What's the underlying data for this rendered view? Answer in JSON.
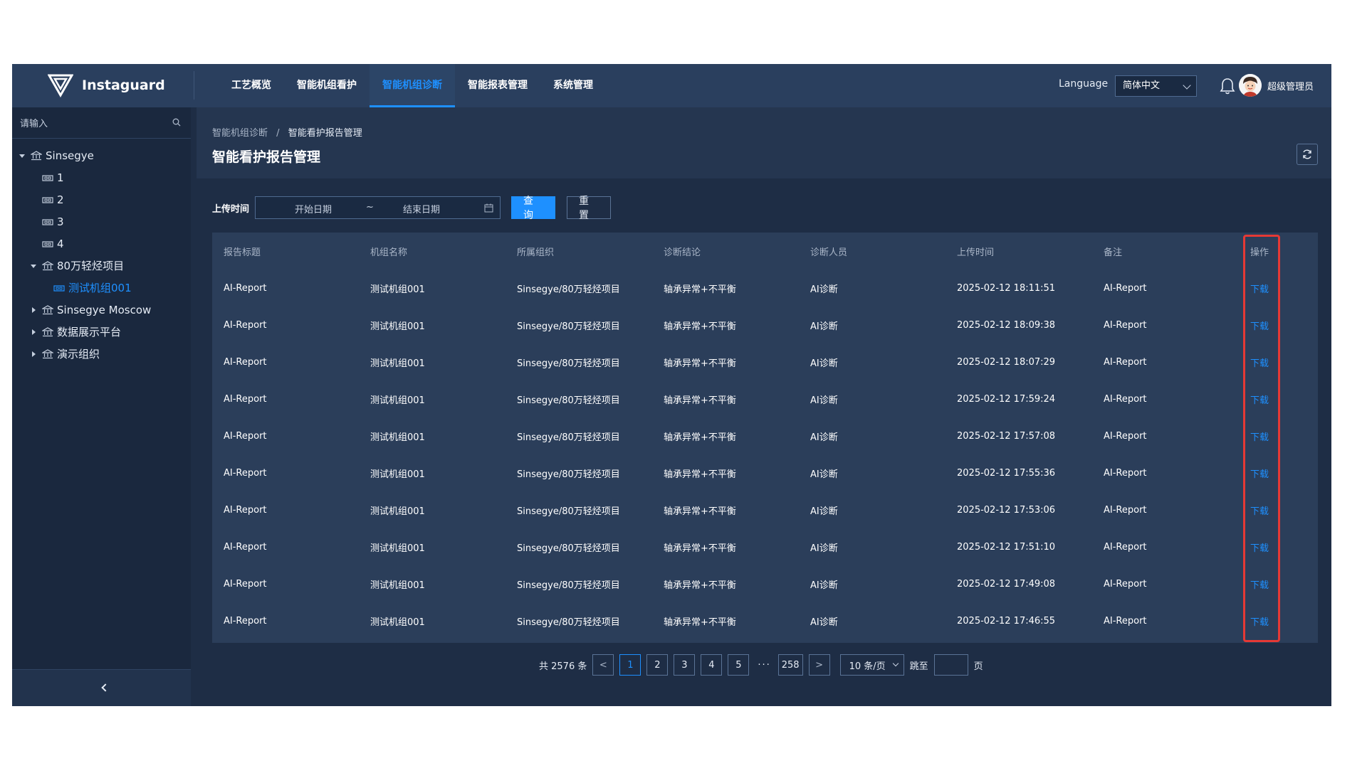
{
  "header": {
    "brand": "Instaguard",
    "nav": [
      {
        "label": "工艺概览",
        "active": false
      },
      {
        "label": "智能机组看护",
        "active": false
      },
      {
        "label": "智能机组诊断",
        "active": true
      },
      {
        "label": "智能报表管理",
        "active": false
      },
      {
        "label": "系统管理",
        "active": false
      }
    ],
    "language_label": "Language",
    "language_value": "简体中文",
    "user_name": "超级管理员"
  },
  "sidebar": {
    "search_placeholder": "请输入",
    "tree": [
      {
        "label": "Sinsegye",
        "level": 0,
        "caret": "down",
        "icon": "org-icon",
        "selected": false
      },
      {
        "label": "1",
        "level": 1,
        "caret": "none",
        "icon": "device-icon",
        "selected": false
      },
      {
        "label": "2",
        "level": 1,
        "caret": "none",
        "icon": "device-icon",
        "selected": false
      },
      {
        "label": "3",
        "level": 1,
        "caret": "none",
        "icon": "device-icon",
        "selected": false
      },
      {
        "label": "4",
        "level": 1,
        "caret": "none",
        "icon": "device-icon",
        "selected": false
      },
      {
        "label": "80万轻烃项目",
        "level": 1,
        "caret": "down",
        "icon": "org-icon",
        "selected": false
      },
      {
        "label": "测试机组001",
        "level": 2,
        "caret": "none",
        "icon": "device-icon",
        "selected": true
      },
      {
        "label": "Sinsegye Moscow",
        "level": 1,
        "caret": "right",
        "icon": "org-icon",
        "selected": false
      },
      {
        "label": "数据展示平台",
        "level": 1,
        "caret": "right",
        "icon": "org-icon",
        "selected": false
      },
      {
        "label": "演示组织",
        "level": 1,
        "caret": "right",
        "icon": "org-icon",
        "selected": false
      }
    ]
  },
  "main": {
    "breadcrumb": [
      "智能机组诊断",
      "智能看护报告管理"
    ],
    "breadcrumb_sep": "/",
    "title": "智能看护报告管理",
    "filter": {
      "label": "上传时间",
      "start_placeholder": "开始日期",
      "tilde": "~",
      "end_placeholder": "结束日期",
      "query_label": "查 询",
      "reset_label": "重 置"
    },
    "table": {
      "columns": [
        "报告标题",
        "机组名称",
        "所属组织",
        "诊断结论",
        "诊断人员",
        "上传时间",
        "备注",
        "操作"
      ],
      "rows": [
        [
          "AI-Report",
          "测试机组001",
          "Sinsegye/80万轻烃项目",
          "轴承异常+不平衡",
          "AI诊断",
          "2025-02-12 18:11:51",
          "AI-Report",
          "下载"
        ],
        [
          "AI-Report",
          "测试机组001",
          "Sinsegye/80万轻烃项目",
          "轴承异常+不平衡",
          "AI诊断",
          "2025-02-12 18:09:38",
          "AI-Report",
          "下载"
        ],
        [
          "AI-Report",
          "测试机组001",
          "Sinsegye/80万轻烃项目",
          "轴承异常+不平衡",
          "AI诊断",
          "2025-02-12 18:07:29",
          "AI-Report",
          "下载"
        ],
        [
          "AI-Report",
          "测试机组001",
          "Sinsegye/80万轻烃项目",
          "轴承异常+不平衡",
          "AI诊断",
          "2025-02-12 17:59:24",
          "AI-Report",
          "下载"
        ],
        [
          "AI-Report",
          "测试机组001",
          "Sinsegye/80万轻烃项目",
          "轴承异常+不平衡",
          "AI诊断",
          "2025-02-12 17:57:08",
          "AI-Report",
          "下载"
        ],
        [
          "AI-Report",
          "测试机组001",
          "Sinsegye/80万轻烃项目",
          "轴承异常+不平衡",
          "AI诊断",
          "2025-02-12 17:55:36",
          "AI-Report",
          "下载"
        ],
        [
          "AI-Report",
          "测试机组001",
          "Sinsegye/80万轻烃项目",
          "轴承异常+不平衡",
          "AI诊断",
          "2025-02-12 17:53:06",
          "AI-Report",
          "下载"
        ],
        [
          "AI-Report",
          "测试机组001",
          "Sinsegye/80万轻烃项目",
          "轴承异常+不平衡",
          "AI诊断",
          "2025-02-12 17:51:10",
          "AI-Report",
          "下载"
        ],
        [
          "AI-Report",
          "测试机组001",
          "Sinsegye/80万轻烃项目",
          "轴承异常+不平衡",
          "AI诊断",
          "2025-02-12 17:49:08",
          "AI-Report",
          "下载"
        ],
        [
          "AI-Report",
          "测试机组001",
          "Sinsegye/80万轻烃项目",
          "轴承异常+不平衡",
          "AI诊断",
          "2025-02-12 17:46:55",
          "AI-Report",
          "下载"
        ]
      ]
    },
    "pagination": {
      "total_text": "共 2576 条",
      "prev": "<",
      "pages": [
        "1",
        "2",
        "3",
        "4",
        "5"
      ],
      "current": "1",
      "ellipsis": "···",
      "last_page": "258",
      "next": ">",
      "page_size": "10 条/页",
      "jump_label": "跳至",
      "page_suffix": "页"
    }
  },
  "colors": {
    "accent": "#1e90ff",
    "highlight": "#e53935",
    "background": "#1e2d45"
  }
}
